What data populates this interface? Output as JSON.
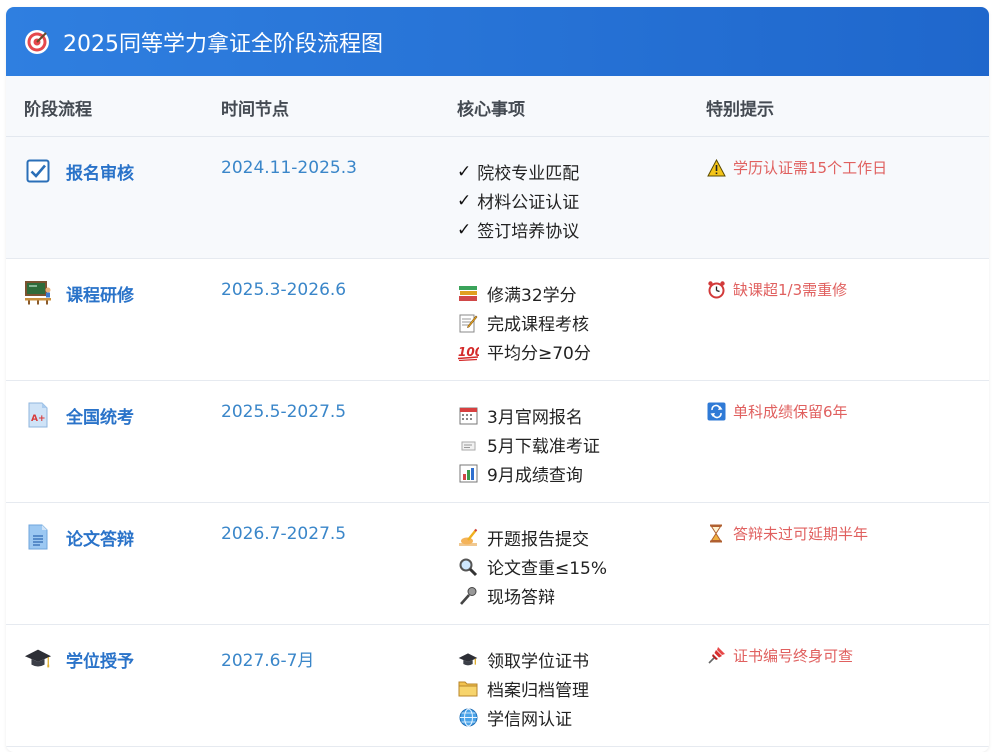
{
  "title": "2025同等学力拿证全阶段流程图",
  "columns": [
    "阶段流程",
    "时间节点",
    "核心事项",
    "特别提示"
  ],
  "colors": {
    "header": "#2a74d8",
    "stage": "#2a73c9",
    "time": "#3a86c9",
    "tip": "#e0605f"
  },
  "rows": [
    {
      "stage": "报名审核",
      "stage_icon": "checkbox-icon",
      "time": "2024.11-2025.3",
      "items": [
        {
          "icon": "check-mark",
          "text": "院校专业匹配"
        },
        {
          "icon": "check-mark",
          "text": "材料公证认证"
        },
        {
          "icon": "check-mark",
          "text": "签订培养协议"
        }
      ],
      "tip_icon": "warning-icon",
      "tip": "学历认证需15个工作日"
    },
    {
      "stage": "课程研修",
      "stage_icon": "classroom-icon",
      "time": "2025.3-2026.6",
      "items": [
        {
          "icon": "books-icon",
          "text": "修满32学分"
        },
        {
          "icon": "memo-icon",
          "text": "完成课程考核"
        },
        {
          "icon": "hundred-icon",
          "text": "平均分≥70分"
        }
      ],
      "tip_icon": "alarm-clock-icon",
      "tip": "缺课超1/3需重修"
    },
    {
      "stage": "全国统考",
      "stage_icon": "grade-paper-icon",
      "time": "2025.5-2027.5",
      "items": [
        {
          "icon": "calendar-icon",
          "text": "3月官网报名"
        },
        {
          "icon": "ticket-icon",
          "text": "5月下载准考证"
        },
        {
          "icon": "bar-chart-icon",
          "text": "9月成绩查询"
        }
      ],
      "tip_icon": "repeat-icon",
      "tip": "单科成绩保留6年"
    },
    {
      "stage": "论文答辩",
      "stage_icon": "document-icon",
      "time": "2026.7-2027.5",
      "items": [
        {
          "icon": "writing-hand-icon",
          "text": "开题报告提交"
        },
        {
          "icon": "magnifier-icon",
          "text": "论文查重≤15%"
        },
        {
          "icon": "microphone-icon",
          "text": "现场答辩"
        }
      ],
      "tip_icon": "hourglass-icon",
      "tip": "答辩未过可延期半年"
    },
    {
      "stage": "学位授予",
      "stage_icon": "graduation-cap-icon",
      "time": "2027.6-7月",
      "items": [
        {
          "icon": "graduation-cap-icon",
          "text": "领取学位证书"
        },
        {
          "icon": "folder-icon",
          "text": "档案归档管理"
        },
        {
          "icon": "globe-icon",
          "text": "学信网认证"
        }
      ],
      "tip_icon": "pushpin-icon",
      "tip": "证书编号终身可查"
    }
  ]
}
